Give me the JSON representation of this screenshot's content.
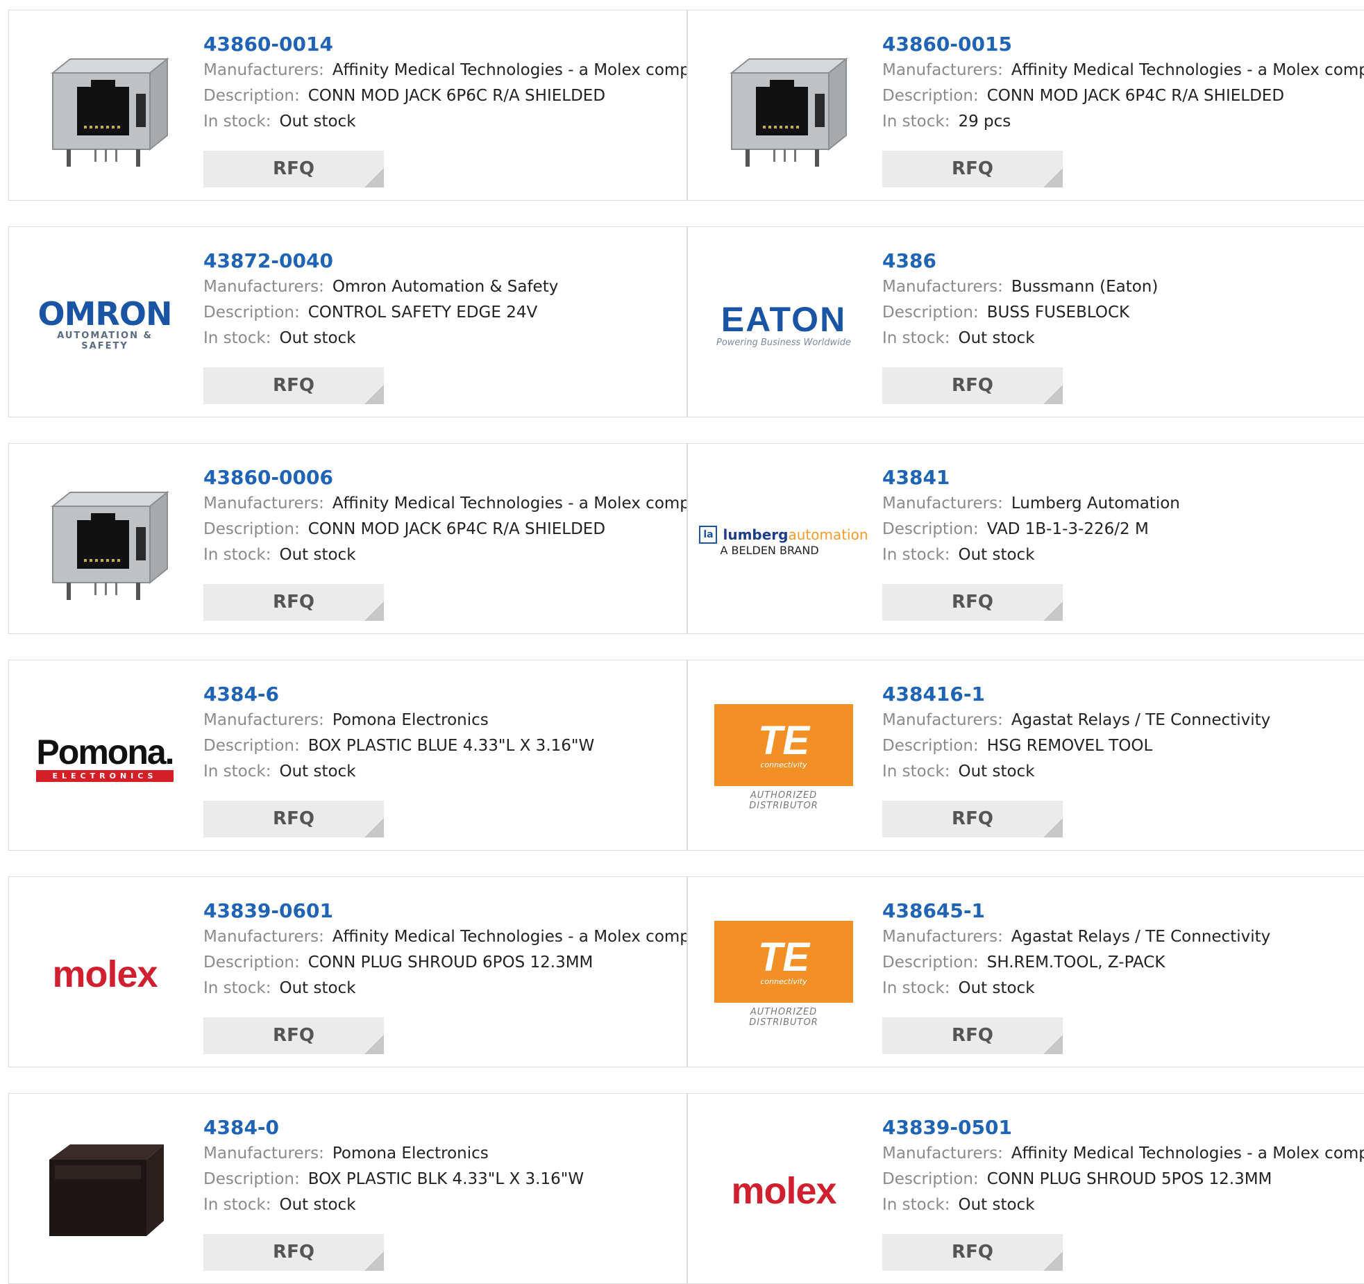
{
  "labels": {
    "manufacturers": "Manufacturers:",
    "description": "Description:",
    "in_stock": "In stock:",
    "rfq": "RFQ"
  },
  "products": [
    {
      "pn": "43860-0014",
      "manufacturer": "Affinity Medical Technologies - a Molex company",
      "description": "CONN MOD JACK 6P6C R/A SHIELDED",
      "stock": "Out stock",
      "image": "rj45-jack-icon"
    },
    {
      "pn": "43860-0015",
      "manufacturer": "Affinity Medical Technologies - a Molex company",
      "description": "CONN MOD JACK 6P4C R/A SHIELDED",
      "stock": "29 pcs",
      "image": "rj45-jack-icon"
    },
    {
      "pn": "43872-0040",
      "manufacturer": "Omron Automation & Safety",
      "description": "CONTROL SAFETY EDGE 24V",
      "stock": "Out stock",
      "image": "omron-logo",
      "logo_text": {
        "big": "OMRON",
        "small": "AUTOMATION & SAFETY"
      }
    },
    {
      "pn": "4386",
      "manufacturer": "Bussmann (Eaton)",
      "description": "BUSS FUSEBLOCK",
      "stock": "Out stock",
      "image": "eaton-logo",
      "logo_text": {
        "big": "EATON",
        "small": "Powering Business Worldwide"
      }
    },
    {
      "pn": "43860-0006",
      "manufacturer": "Affinity Medical Technologies - a Molex company",
      "description": "CONN MOD JACK 6P4C R/A SHIELDED",
      "stock": "Out stock",
      "image": "rj45-jack-icon"
    },
    {
      "pn": "43841",
      "manufacturer": "Lumberg Automation",
      "description": "VAD 1B-1-3-226/2 M",
      "stock": "Out stock",
      "image": "lumberg-logo",
      "logo_text": {
        "box": "la",
        "word1": "lumberg",
        "word2": "automation",
        "small": "A BELDEN BRAND"
      }
    },
    {
      "pn": "4384-6",
      "manufacturer": "Pomona Electronics",
      "description": "BOX PLASTIC BLUE 4.33\"L X 3.16\"W",
      "stock": "Out stock",
      "image": "pomona-logo",
      "logo_text": {
        "big": "Pomona.",
        "small": "ELECTRONICS"
      }
    },
    {
      "pn": "438416-1",
      "manufacturer": "Agastat Relays / TE Connectivity",
      "description": "HSG REMOVEL TOOL",
      "stock": "Out stock",
      "image": "te-logo",
      "logo_text": {
        "big": "TE",
        "small": "connectivity",
        "auth": "AUTHORIZED DISTRIBUTOR"
      }
    },
    {
      "pn": "43839-0601",
      "manufacturer": "Affinity Medical Technologies - a Molex company",
      "description": "CONN PLUG SHROUD 6POS 12.3MM",
      "stock": "Out stock",
      "image": "molex-logo",
      "logo_text": {
        "big": "molex"
      }
    },
    {
      "pn": "438645-1",
      "manufacturer": "Agastat Relays / TE Connectivity",
      "description": "SH.REM.TOOL, Z-PACK",
      "stock": "Out stock",
      "image": "te-logo",
      "logo_text": {
        "big": "TE",
        "small": "connectivity",
        "auth": "AUTHORIZED DISTRIBUTOR"
      }
    },
    {
      "pn": "4384-0",
      "manufacturer": "Pomona Electronics",
      "description": "BOX PLASTIC BLK 4.33\"L X 3.16\"W",
      "stock": "Out stock",
      "image": "black-box-icon"
    },
    {
      "pn": "43839-0501",
      "manufacturer": "Affinity Medical Technologies - a Molex company",
      "description": "CONN PLUG SHROUD 5POS 12.3MM",
      "stock": "Out stock",
      "image": "molex-logo",
      "logo_text": {
        "big": "molex"
      }
    }
  ],
  "colors": {
    "part_number": "#1f64b4",
    "label": "#8a8a8a",
    "rfq_bg": "#ebebeb",
    "border": "#dcdcdc"
  }
}
